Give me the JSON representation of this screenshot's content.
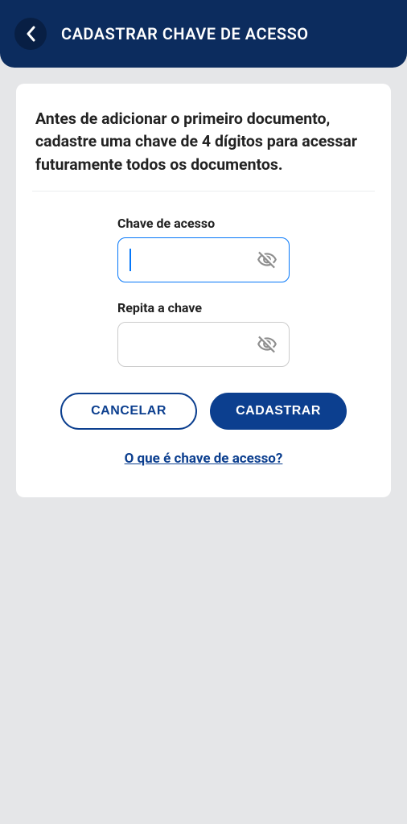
{
  "header": {
    "title": "CADASTRAR CHAVE DE ACESSO"
  },
  "card": {
    "instructions": "Antes de adicionar o primeiro documento, cadastre uma chave de 4 dígitos para acessar futuramente todos os documentos.",
    "fields": {
      "access_key": {
        "label": "Chave de acesso",
        "value": ""
      },
      "repeat_key": {
        "label": "Repita a chave",
        "value": ""
      }
    },
    "buttons": {
      "cancel": "CANCELAR",
      "submit": "CADASTRAR"
    },
    "help_link": "O que é chave de acesso?"
  }
}
